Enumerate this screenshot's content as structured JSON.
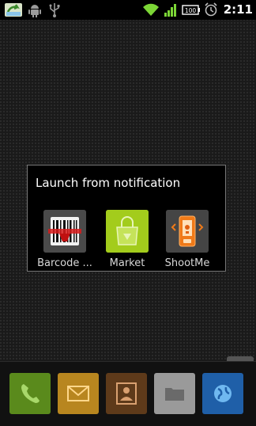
{
  "status_bar": {
    "time": "2:11",
    "battery_label": "100",
    "icons": [
      "notification-app-icon",
      "android-debug-icon",
      "usb-icon",
      "wifi-icon",
      "signal-icon",
      "battery-icon",
      "alarm-icon"
    ]
  },
  "dialog": {
    "title": "Launch from notification",
    "apps": [
      {
        "label": "Barcode ...",
        "icon": "barcode-scanner-icon"
      },
      {
        "label": "Market",
        "icon": "market-icon"
      },
      {
        "label": "ShootMe",
        "icon": "shootme-icon"
      }
    ]
  },
  "dock": {
    "items": [
      {
        "icon": "phone-icon",
        "color": "#5a8a1c"
      },
      {
        "icon": "mail-icon",
        "color": "#b8861f"
      },
      {
        "icon": "contacts-icon",
        "color": "#5e3a1a"
      },
      {
        "icon": "folder-icon",
        "color": "#9a9a9a"
      },
      {
        "icon": "browser-icon",
        "color": "#1f5fa8"
      }
    ]
  }
}
